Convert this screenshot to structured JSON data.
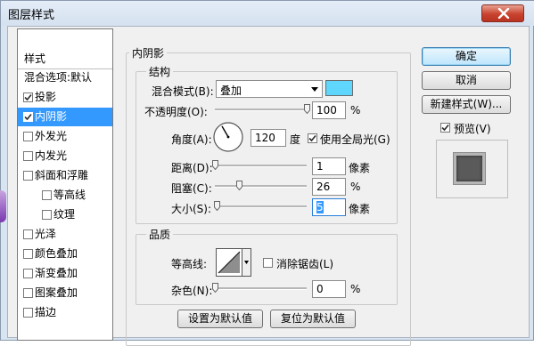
{
  "window": {
    "title": "图层样式",
    "close_icon": "close-icon"
  },
  "styles_panel": {
    "header": "样式",
    "items": [
      {
        "label": "混合选项:默认",
        "checkbox": false,
        "checked": false,
        "indent": false
      },
      {
        "label": "投影",
        "checkbox": true,
        "checked": true,
        "indent": false
      },
      {
        "label": "内阴影",
        "checkbox": true,
        "checked": true,
        "indent": false,
        "selected": true
      },
      {
        "label": "外发光",
        "checkbox": true,
        "checked": false,
        "indent": false
      },
      {
        "label": "内发光",
        "checkbox": true,
        "checked": false,
        "indent": false
      },
      {
        "label": "斜面和浮雕",
        "checkbox": true,
        "checked": false,
        "indent": false
      },
      {
        "label": "等高线",
        "checkbox": true,
        "checked": false,
        "indent": true
      },
      {
        "label": "纹理",
        "checkbox": true,
        "checked": false,
        "indent": true
      },
      {
        "label": "光泽",
        "checkbox": true,
        "checked": false,
        "indent": false
      },
      {
        "label": "颜色叠加",
        "checkbox": true,
        "checked": false,
        "indent": false
      },
      {
        "label": "渐变叠加",
        "checkbox": true,
        "checked": false,
        "indent": false
      },
      {
        "label": "图案叠加",
        "checkbox": true,
        "checked": false,
        "indent": false
      },
      {
        "label": "描边",
        "checkbox": true,
        "checked": false,
        "indent": false
      }
    ]
  },
  "inner_shadow": {
    "title": "内阴影",
    "structure": {
      "title": "结构",
      "blend_mode": {
        "label": "混合模式(B):",
        "value": "叠加",
        "color": "#5fd6fb"
      },
      "opacity": {
        "label": "不透明度(O):",
        "value": "100",
        "unit": "%",
        "slider_fraction": 1.0
      },
      "angle": {
        "label": "角度(A):",
        "value": "120",
        "unit": "度",
        "degrees": 120
      },
      "global_light": {
        "label": "使用全局光(G)",
        "checked": true
      },
      "distance": {
        "label": "距离(D):",
        "value": "1",
        "unit": "像素",
        "slider_fraction": 0.0
      },
      "choke": {
        "label": "阻塞(C):",
        "value": "26",
        "unit": "%",
        "slider_fraction": 0.26
      },
      "size": {
        "label": "大小(S):",
        "value": "5",
        "unit": "像素",
        "slider_fraction": 0.02
      }
    },
    "quality": {
      "title": "品质",
      "contour": {
        "label": "等高线:"
      },
      "anti_alias": {
        "label": "消除锯齿(L)",
        "checked": false
      },
      "noise": {
        "label": "杂色(N):",
        "value": "0",
        "unit": "%",
        "slider_fraction": 0.0
      }
    },
    "make_default": "设置为默认值",
    "reset_default": "复位为默认值"
  },
  "actions": {
    "ok": "确定",
    "cancel": "取消",
    "new_style": "新建样式(W)...",
    "preview": {
      "label": "预览(V)",
      "checked": true
    }
  }
}
